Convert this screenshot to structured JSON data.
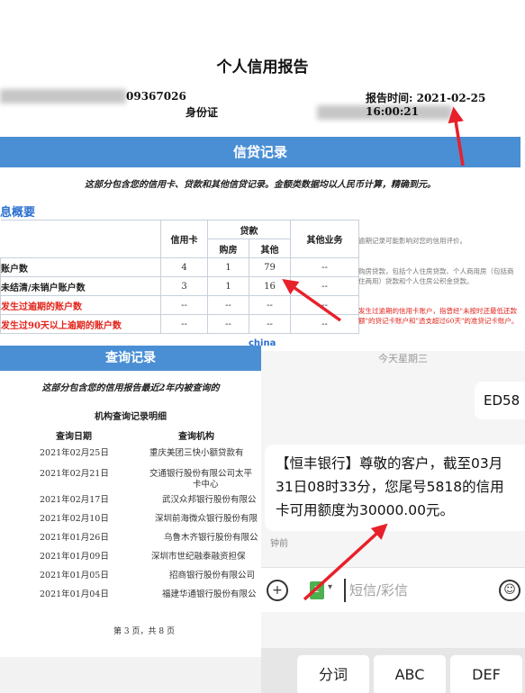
{
  "report": {
    "title": "个人信用报告",
    "id_number_suffix": "09367026",
    "id_type": "身份证",
    "report_time_label": "报告时间: 2021-02-25 16:00:21",
    "credit_section_title": "信贷记录",
    "credit_section_note": "这部分包含您的信用卡、贷款和其他信贷记录。金额类数据均以人民币计算，精确到元。",
    "summary_heading": "息概要",
    "table": {
      "header_credit_card": "信用卡",
      "header_loan": "贷款",
      "header_house": "购房",
      "header_other": "其他",
      "header_other_business": "其他业务",
      "rows": [
        {
          "label": "账户数",
          "red": false,
          "cells": [
            "4",
            "1",
            "79",
            "--"
          ]
        },
        {
          "label": "未结清/未销户账户数",
          "red": false,
          "cells": [
            "3",
            "1",
            "16",
            "--"
          ]
        },
        {
          "label": "发生过逾期的账户数",
          "red": true,
          "cells": [
            "--",
            "--",
            "--",
            "--"
          ]
        },
        {
          "label": "发生过90天以上逾期的账户数",
          "red": true,
          "cells": [
            "--",
            "--",
            "--",
            "--"
          ]
        }
      ]
    },
    "side_notes": [
      "逾期记录可能影响对您的信用评价。",
      "购房贷款，包括个人住房贷款、个人商用房（包括商住两用）贷款和个人住房公积金贷款。",
      "发生过逾期的信用卡账户，指曾经\"未按时还最低还款额\"的贷记卡账户和\"透支超过60天\"的准贷记卡账户。"
    ],
    "china_tag": "china",
    "query_section_title": "查询记录",
    "query_section_note": "这部分包含您的信用报告最近2年内被查询的",
    "query_subtitle": "机构查询记录明细",
    "query_col_date": "查询日期",
    "query_col_org": "查询机构",
    "queries": [
      {
        "date": "2021年02月25日",
        "org": "重庆美团三快小额贷款有"
      },
      {
        "date": "2021年02月21日",
        "org": "交通银行股份有限公司太平"
      },
      {
        "date": "2021年02月17日",
        "org": "武汉众邦银行股份有限公"
      },
      {
        "date": "2021年02月10日",
        "org": "深圳前海微众银行股份有限"
      },
      {
        "date": "2021年01月26日",
        "org": "乌鲁木齐银行股份有限公"
      },
      {
        "date": "2021年01月09日",
        "org": "深圳市世纪融泰融资担保"
      },
      {
        "date": "2021年01月05日",
        "org": "招商银行股份有限公司"
      },
      {
        "date": "2021年01月04日",
        "org": "福建华通银行股份有限公"
      }
    ],
    "query_org_second_line": "卡中心",
    "page_label": "第 3 页，共 8 页"
  },
  "phone": {
    "top_text": "今天星期三",
    "bubble_right_text": "ED58",
    "sms_text": "【恒丰银行】尊敬的客户，截至03月31日08时33分，您尾号5818的信用卡可用额度为30000.00元。",
    "sms_time": "钟前",
    "input_placeholder": "短信/彩信",
    "sim_label": "2",
    "keys": [
      "分词",
      "ABC",
      "DEF"
    ]
  },
  "colors": {
    "section_blue": "#4a8fd4",
    "warning_red": "#e2231a",
    "arrow_red": "#e8202a",
    "sim_green": "#4caf50"
  }
}
